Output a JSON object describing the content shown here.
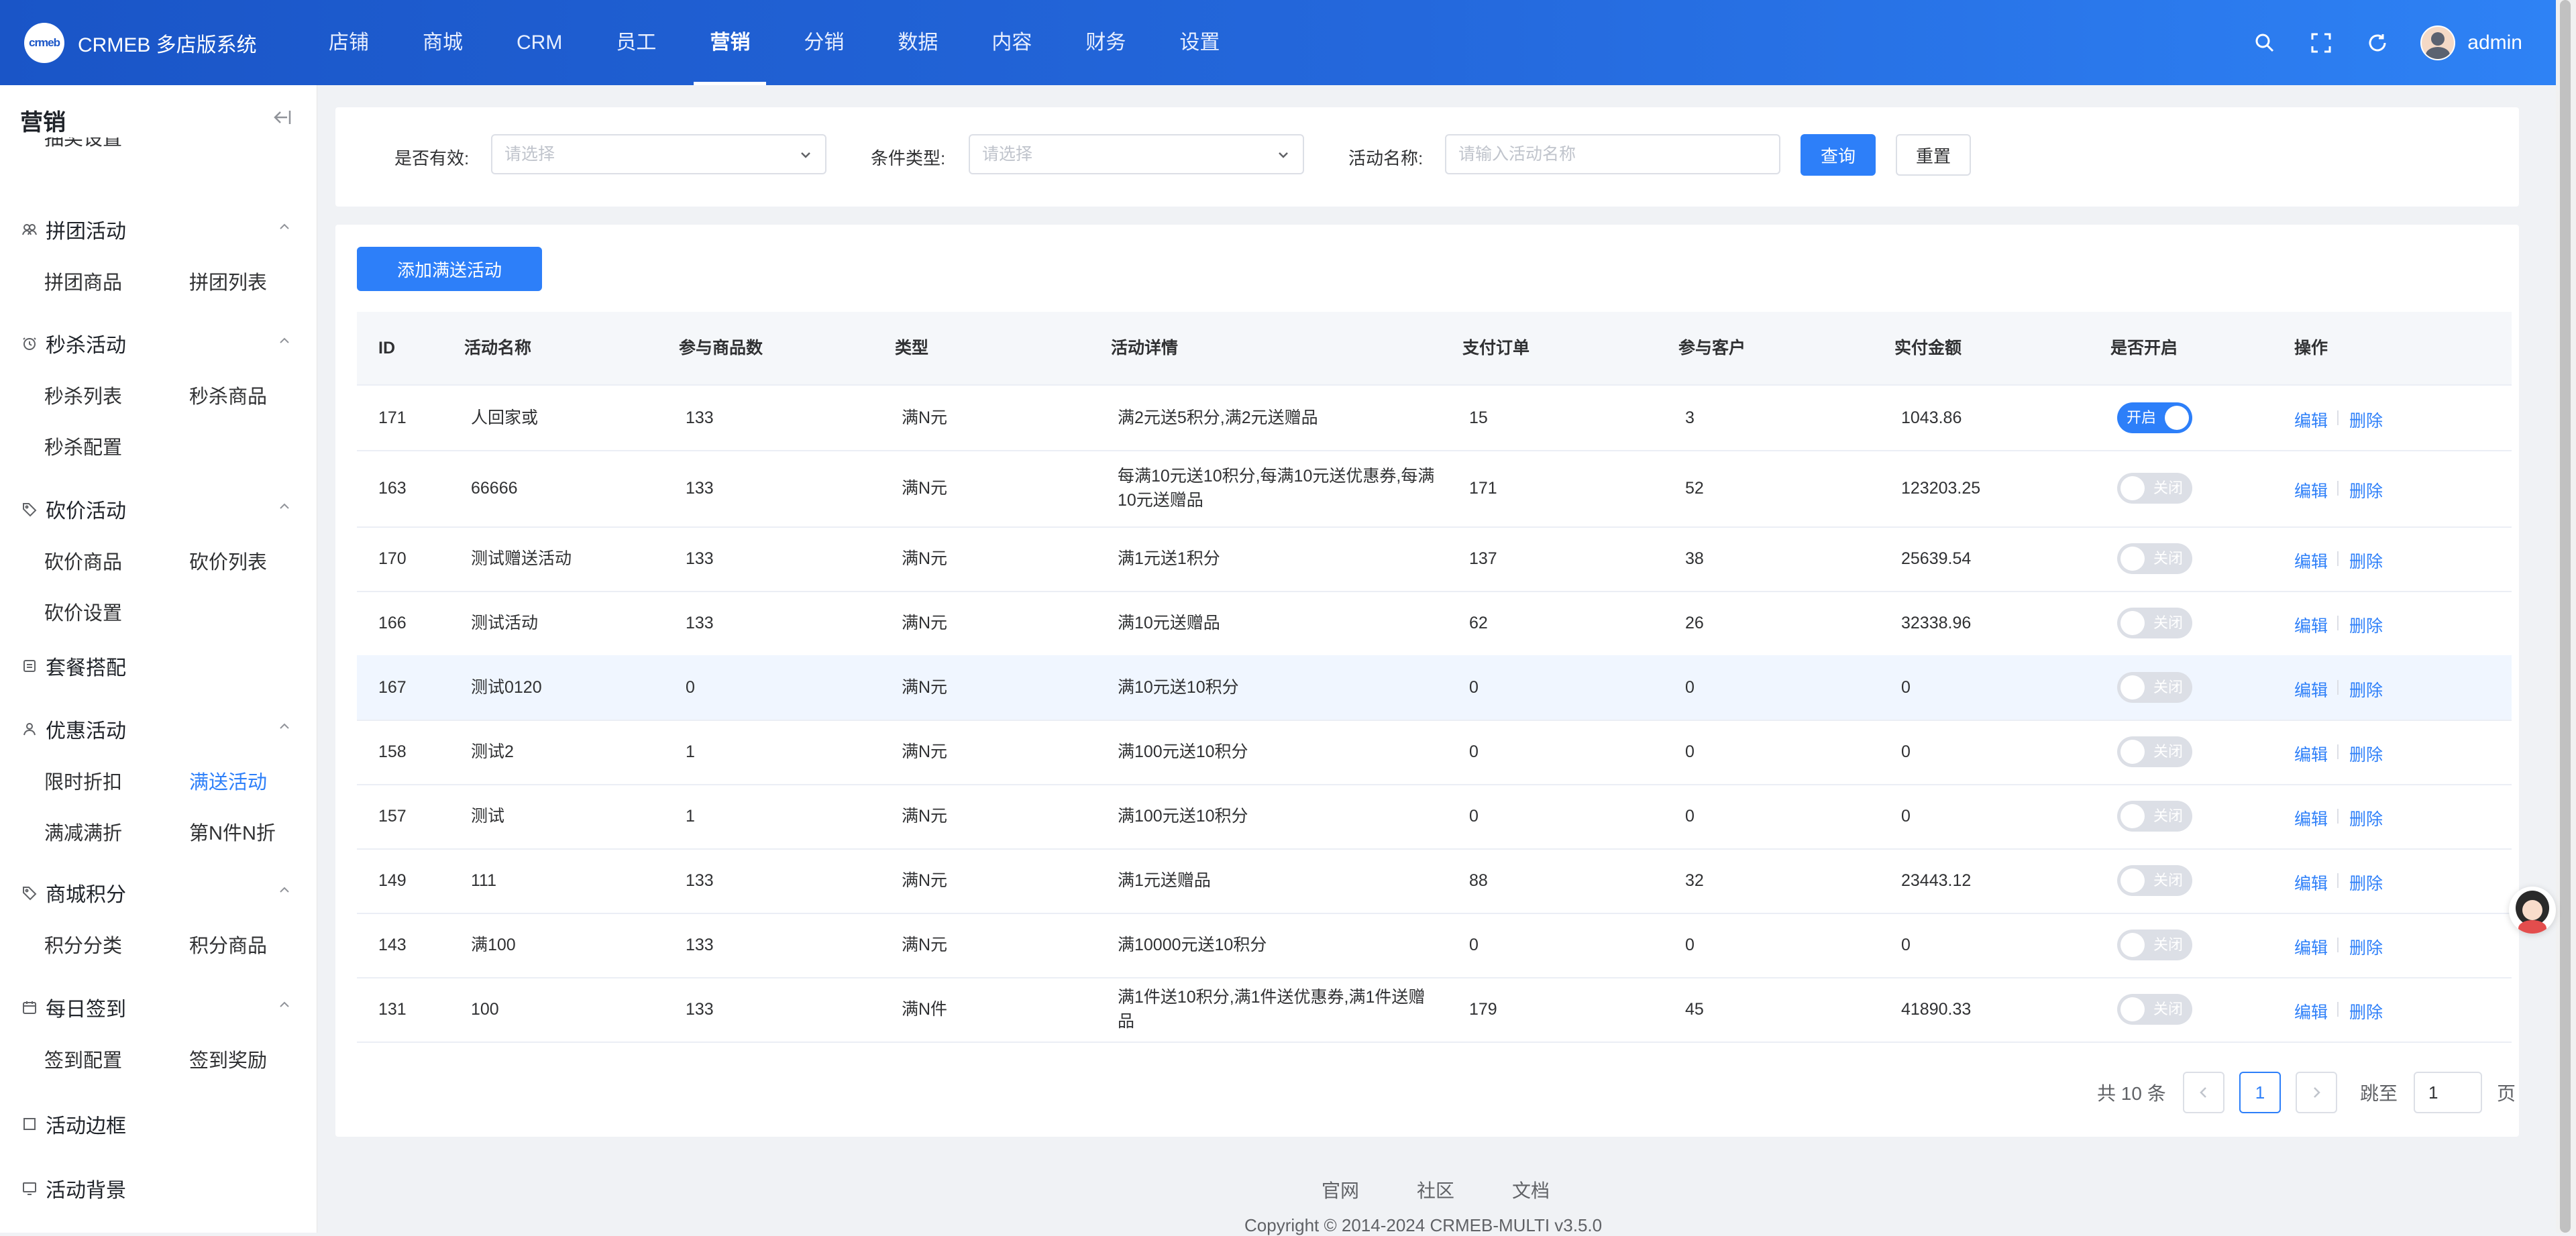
{
  "brand": {
    "logo_text": "crmeb",
    "title": "CRMEB 多店版系统"
  },
  "nav": {
    "items": [
      "店铺",
      "商城",
      "CRM",
      "员工",
      "营销",
      "分销",
      "数据",
      "内容",
      "财务",
      "设置"
    ],
    "active": "营销"
  },
  "user": {
    "name": "admin"
  },
  "sidebar": {
    "title": "营销",
    "partial_item": "抽奖设置",
    "groups": [
      {
        "title": "拼团活动",
        "icon": "group-buy-icon",
        "items": [
          "拼团商品",
          "拼团列表"
        ]
      },
      {
        "title": "秒杀活动",
        "icon": "clock-icon",
        "items": [
          "秒杀列表",
          "秒杀商品",
          "秒杀配置"
        ]
      },
      {
        "title": "砍价活动",
        "icon": "tag-icon",
        "items": [
          "砍价商品",
          "砍价列表",
          "砍价设置"
        ]
      },
      {
        "title": "套餐搭配",
        "icon": "package-icon",
        "items": []
      },
      {
        "title": "优惠活动",
        "icon": "discount-icon",
        "items": [
          "限时折扣",
          "满送活动",
          "满减满折",
          "第N件N折"
        ]
      },
      {
        "title": "商城积分",
        "icon": "tag-icon",
        "items": [
          "积分分类",
          "积分商品"
        ]
      },
      {
        "title": "每日签到",
        "icon": "calendar-icon",
        "items": [
          "签到配置",
          "签到奖励"
        ]
      },
      {
        "title": "活动边框",
        "icon": "frame-icon",
        "items": []
      },
      {
        "title": "活动背景",
        "icon": "screen-icon",
        "items": []
      }
    ],
    "active_item": "满送活动"
  },
  "filters": {
    "is_valid_label": "是否有效:",
    "is_valid_placeholder": "请选择",
    "condition_type_label": "条件类型:",
    "condition_type_placeholder": "请选择",
    "activity_name_label": "活动名称:",
    "activity_name_placeholder": "请输入活动名称",
    "search_button": "查询",
    "reset_button": "重置"
  },
  "add_button": "添加满送活动",
  "table": {
    "columns": [
      "ID",
      "活动名称",
      "参与商品数",
      "类型",
      "活动详情",
      "支付订单",
      "参与客户",
      "实付金额",
      "是否开启",
      "操作"
    ],
    "switch_on_text": "开启",
    "switch_off_text": "关闭",
    "edit_label": "编辑",
    "delete_label": "删除",
    "rows": [
      {
        "id": "171",
        "name": "人回家或",
        "goods": "133",
        "type": "满N元",
        "detail": "满2元送5积分,满2元送赠品",
        "orders": "15",
        "customers": "3",
        "amount": "1043.86",
        "enabled": true
      },
      {
        "id": "163",
        "name": "66666",
        "goods": "133",
        "type": "满N元",
        "detail": "每满10元送10积分,每满10元送优惠券,每满10元送赠品",
        "orders": "171",
        "customers": "52",
        "amount": "123203.25",
        "enabled": false
      },
      {
        "id": "170",
        "name": "测试赠送活动",
        "goods": "133",
        "type": "满N元",
        "detail": "满1元送1积分",
        "orders": "137",
        "customers": "38",
        "amount": "25639.54",
        "enabled": false
      },
      {
        "id": "166",
        "name": "测试活动",
        "goods": "133",
        "type": "满N元",
        "detail": "满10元送赠品",
        "orders": "62",
        "customers": "26",
        "amount": "32338.96",
        "enabled": false
      },
      {
        "id": "167",
        "name": "测试0120",
        "goods": "0",
        "type": "满N元",
        "detail": "满10元送10积分",
        "orders": "0",
        "customers": "0",
        "amount": "0",
        "enabled": false
      },
      {
        "id": "158",
        "name": "测试2",
        "goods": "1",
        "type": "满N元",
        "detail": "满100元送10积分",
        "orders": "0",
        "customers": "0",
        "amount": "0",
        "enabled": false
      },
      {
        "id": "157",
        "name": "测试",
        "goods": "1",
        "type": "满N元",
        "detail": "满100元送10积分",
        "orders": "0",
        "customers": "0",
        "amount": "0",
        "enabled": false
      },
      {
        "id": "149",
        "name": "111",
        "goods": "133",
        "type": "满N元",
        "detail": "满1元送赠品",
        "orders": "88",
        "customers": "32",
        "amount": "23443.12",
        "enabled": false
      },
      {
        "id": "143",
        "name": "满100",
        "goods": "133",
        "type": "满N元",
        "detail": "满10000元送10积分",
        "orders": "0",
        "customers": "0",
        "amount": "0",
        "enabled": false
      },
      {
        "id": "131",
        "name": "100",
        "goods": "133",
        "type": "满N件",
        "detail": "满1件送10积分,满1件送优惠券,满1件送赠品",
        "orders": "179",
        "customers": "45",
        "amount": "41890.33",
        "enabled": false
      }
    ]
  },
  "pagination": {
    "total_text": "共 10 条",
    "current_page": "1",
    "jump_label": "跳至",
    "jump_value": "1",
    "page_suffix": "页"
  },
  "footer": {
    "links": [
      "官网",
      "社区",
      "文档"
    ],
    "copyright": "Copyright © 2014-2024 CRMEB-MULTI v3.5.0"
  },
  "colors": {
    "primary": "#2d7ff9",
    "header_from": "#1a55c7",
    "header_to": "#2e82f5"
  }
}
